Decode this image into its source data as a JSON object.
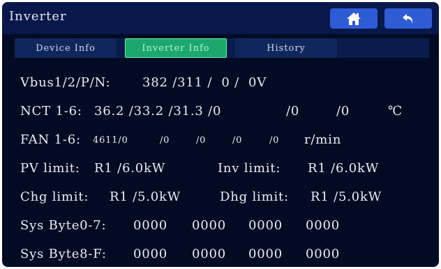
{
  "header": {
    "title": "Inverter",
    "home_icon": "home-icon",
    "back_icon": "back-arrow-icon",
    "accent": "#2d5cd6"
  },
  "tabs": [
    {
      "label": "Device Info",
      "active": false
    },
    {
      "label": "Inverter Info",
      "active": true
    },
    {
      "label": "History",
      "active": false
    }
  ],
  "rows": {
    "vbus": {
      "label": "Vbus1/2/P/N:",
      "value": "382 /311 /  0 /  0V"
    },
    "nct": {
      "label": "NCT 1-6:",
      "values": [
        "36.2 /33.2 /31.3 /0",
        "/0",
        "/0"
      ],
      "unit": "℃"
    },
    "fan": {
      "label": "FAN 1-6:",
      "values": [
        "4611/0",
        "/0",
        "/0",
        "/0",
        "/0"
      ],
      "unit": "r/min"
    },
    "limits1": {
      "left_label": "PV limit:",
      "left_value": "R1 /6.0kW",
      "right_label": "Inv limit:",
      "right_value": "R1 /6.0kW"
    },
    "limits2": {
      "left_label": "Chg limit:",
      "left_value": "R1 /5.0kW",
      "right_label": "Dhg limit:",
      "right_value": "R1 /5.0kW"
    },
    "sys07": {
      "label": "Sys Byte0-7:",
      "values": [
        "0000",
        "0000",
        "0000",
        "0000"
      ]
    },
    "sys8f": {
      "label": "Sys Byte8-F:",
      "values": [
        "0000",
        "0000",
        "0000",
        "0000"
      ]
    }
  }
}
